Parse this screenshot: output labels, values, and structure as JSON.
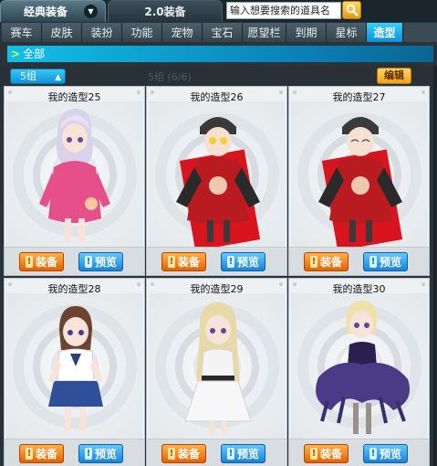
{
  "top_tabs": {
    "active_label": "经典装备",
    "inactive_label": "2.0装备",
    "search_placeholder": "输入想要搜索的道具名"
  },
  "categories": [
    "赛车",
    "皮肤",
    "装扮",
    "功能",
    "宠物",
    "宝石",
    "愿望栏",
    "到期",
    "星标",
    "造型"
  ],
  "active_category": "造型",
  "filter": {
    "all_label": "全部"
  },
  "group": {
    "select_label": "5组",
    "count_text": "5组 (6/6)",
    "edit_label": "编辑"
  },
  "cards": [
    {
      "title": "我的造型25"
    },
    {
      "title": "我的造型26"
    },
    {
      "title": "我的造型27"
    },
    {
      "title": "我的造型28"
    },
    {
      "title": "我的造型29"
    },
    {
      "title": "我的造型30"
    }
  ],
  "card_buttons": {
    "equip": "装备",
    "preview": "预览"
  },
  "colors": {
    "accent_blue": "#0e93d6",
    "equip_orange": "#e66200",
    "edit_yellow": "#f0a21a"
  }
}
